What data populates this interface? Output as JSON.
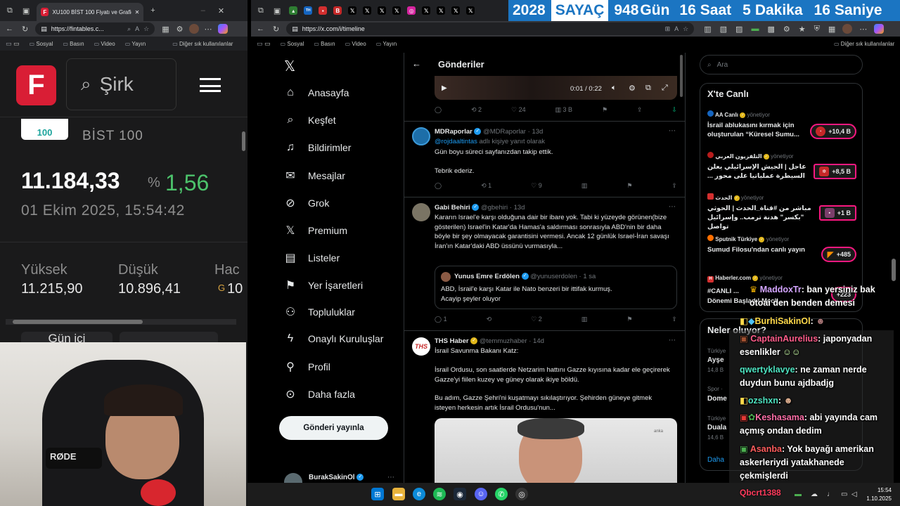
{
  "left_browser": {
    "tab_title": "XU100 BİST 100 Fiyatı ve Grafiği",
    "url": "https://fintables.c...",
    "bookmarks": [
      "Sosyal",
      "Basın",
      "Video",
      "Yayın"
    ],
    "other_bookmarks": "Diğer sık kullanılanlar"
  },
  "fintables": {
    "logo": "F",
    "search_placeholder": "Şirk",
    "index_badge": "100",
    "index_name": "BİST 100",
    "price": "11.184,33",
    "pct_sign": "%",
    "change": "1,56",
    "datetime": "01 Ekim 2025, 15:54:42",
    "high_label": "Yüksek",
    "high_value": "11.215,90",
    "low_label": "Düşük",
    "low_value": "10.896,41",
    "vol_label": "Hac",
    "vol_value": "10",
    "vol_prefix": "G",
    "tab": "Gün içi"
  },
  "right_browser": {
    "url": "https://x.com/i/timeline",
    "bookmarks": [
      "Sosyal",
      "Basın",
      "Video",
      "Yayın"
    ],
    "other_bookmarks": "Diğer sık kullanılanlar"
  },
  "counter": {
    "year": "2028",
    "label": "SAYAÇ",
    "days": "948",
    "days_unit": "Gün",
    "hours": "16",
    "hours_unit": "Saat",
    "minutes": "5",
    "minutes_unit": "Dakika",
    "seconds": "16",
    "seconds_unit": "Saniye"
  },
  "x_nav": {
    "items": [
      "Anasayfa",
      "Keşfet",
      "Bildirimler",
      "Mesajlar",
      "Grok",
      "Premium",
      "Listeler",
      "Yer İşaretleri",
      "Topluluklar",
      "Onaylı Kuruluşlar",
      "Profil",
      "Daha fazla"
    ],
    "post_button": "Gönderi yayınla",
    "account_name": "BurakSakinOl"
  },
  "timeline": {
    "title": "Gönderiler",
    "video_time": "0:01 / 0:22",
    "first_actions": {
      "retweets": "2",
      "likes": "24",
      "views": "3 B"
    },
    "tweets": [
      {
        "name": "MDRaporlar",
        "handle": "@MDRaporlar",
        "time": "13d",
        "reply_to": "@rojdaaltintas",
        "reply_suffix": "adlı kişiye yanıt olarak",
        "text1": "Gün boyu süreci sayfanızdan takip ettik.",
        "text2": "Tebrik ederiz.",
        "retweets": "1",
        "likes": "9"
      },
      {
        "name": "Gabi Behiri",
        "handle": "@gbehiri",
        "time": "13d",
        "text": "Kararın Israel'e karşı olduğuna dair bir ibare yok. Tabi ki yüzeyde görünen(bize gösterilen) Israel'in Katar'da Hamas'a saldırması sonrasıyla ABD'nin bir daha böyle bir şey olmayacak garantisini vermesi. Ancak 12 günlük Israel-İran savaşı İran'ın Katar'daki ABD üssünü vurmasıyla...",
        "quote_name": "Yunus Emre Erdölen",
        "quote_handle": "@yunuserdolen",
        "quote_time": "1 sa",
        "quote_text1": "ABD, İsrail'e karşı Katar ile Nato benzeri bir ittifak kurmuş.",
        "quote_text2": "Acayip şeyler oluyor",
        "replies": "1",
        "likes": "2"
      },
      {
        "name": "THS Haber",
        "handle": "@temmuzhaber",
        "time": "14d",
        "text1": "İsrail Savunma Bakanı Katz:",
        "text2": "İsrail Ordusu, son saatlerde Netzarim hattını Gazze kıyısına kadar ele geçirerek Gazze'yi fiilen kuzey ve güney olarak ikiye böldü.",
        "text3": "Bu adım, Gazze Şehri'ni kuşatmayı sıkılaştırıyor. Şehirden güneye gitmek isteyen herkesin artık İsrail Ordusu'nun...",
        "image_watermark": "anka"
      }
    ]
  },
  "sidebar": {
    "search_placeholder": "Ara",
    "live_title": "X'te Canlı",
    "live": [
      {
        "source": "AA Canlı",
        "role": "yönetiyor",
        "text": "İsrail ablukasını kırmak için oluşturulan “Küresel Sumu...",
        "count": "+10,4 B"
      },
      {
        "source": "التلفزيون العربي",
        "role": "yönetiyor",
        "text": "عاجل | الجيش الإسرائيلي يعلن السيطرة عملياتيا على محور ...",
        "count": "+8,5 B"
      },
      {
        "source": "الحدث",
        "role": "yönetiyor",
        "text": "مباشر من #قناة_الحدث | الحوثي \"بكسر\" هدنة ترمب.. وإسرائيل تواصل",
        "count": "+1 B"
      },
      {
        "source": "Sputnik Türkiye",
        "role": "yönetiyor",
        "text": "Sumud Filosu'ndan canlı yayın",
        "count": "+485"
      },
      {
        "source": "Haberler.com",
        "role": "yönetiyor",
        "text": "#CANLI ...",
        "count": "+223"
      }
    ],
    "live_more": "Dönemi Başladı! Mecli...",
    "trends_title": "Neler oluyor?",
    "trend_bits": [
      "Türkiye",
      "Ayşe",
      "14,8 B",
      "Spor ·",
      "Dome",
      "Türkiye",
      "Duala",
      "14,6 B",
      "Daha"
    ]
  },
  "chat": [
    {
      "user": "MaddoxTr",
      "msg": "ban yersiniz bak otoai den benden demesi",
      "color": "#d4a5ff"
    },
    {
      "user": "BurhiSakinOl",
      "msg": "",
      "color": "#ffd94a"
    },
    {
      "user": "CaptainAurelius",
      "msg": "japonyadan esenlikler",
      "color": "#ff5c8a"
    },
    {
      "user": "qwertyklavye",
      "msg": "ne zaman nerde duydun bunu ajdbadjg",
      "color": "#4de3c0"
    },
    {
      "user": "ozshxn",
      "msg": "",
      "color": "#4de3c0"
    },
    {
      "user": "Keshasama",
      "msg": "abi yayında cam açmış ondan dedim",
      "color": "#ff6fa8"
    },
    {
      "user": "Asanba",
      "msg": "Yok bayağı amerikan askerleriydi yatakhanede çekmişlerdi",
      "color": "#ff5c5c"
    },
    {
      "user": "Qbcrt1388",
      "msg": "",
      "color": "#ff3b5c"
    }
  ],
  "taskbar": {
    "time": "15:54",
    "date": "1.10.2025"
  }
}
